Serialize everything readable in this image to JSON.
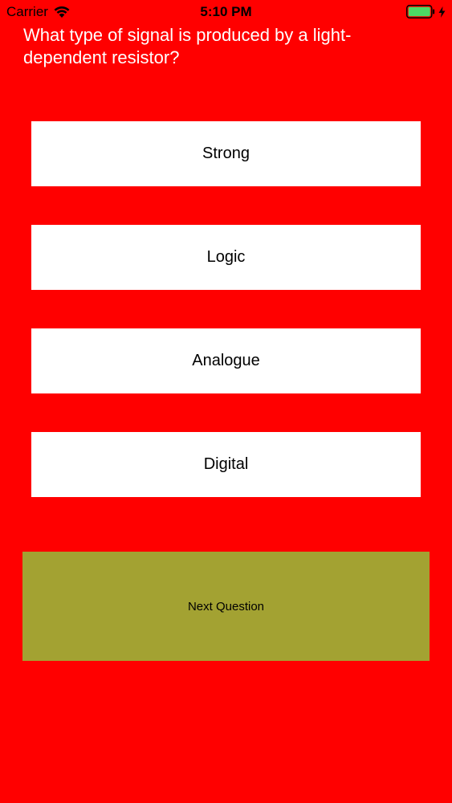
{
  "colors": {
    "background": "#ff0000",
    "answer_button": "#ffffff",
    "next_button": "#a3a232",
    "question_text": "#ffffff",
    "battery_fill": "#4cd964"
  },
  "status_bar": {
    "carrier": "Carrier",
    "time": "5:10 PM",
    "icons": [
      "wifi-icon",
      "battery-icon",
      "charging-bolt-icon"
    ]
  },
  "quiz": {
    "question": "What type of signal is produced by a light-dependent resistor?",
    "answers": [
      {
        "label": "Strong"
      },
      {
        "label": "Logic"
      },
      {
        "label": "Analogue"
      },
      {
        "label": "Digital"
      }
    ],
    "next_label": "Next Question"
  }
}
